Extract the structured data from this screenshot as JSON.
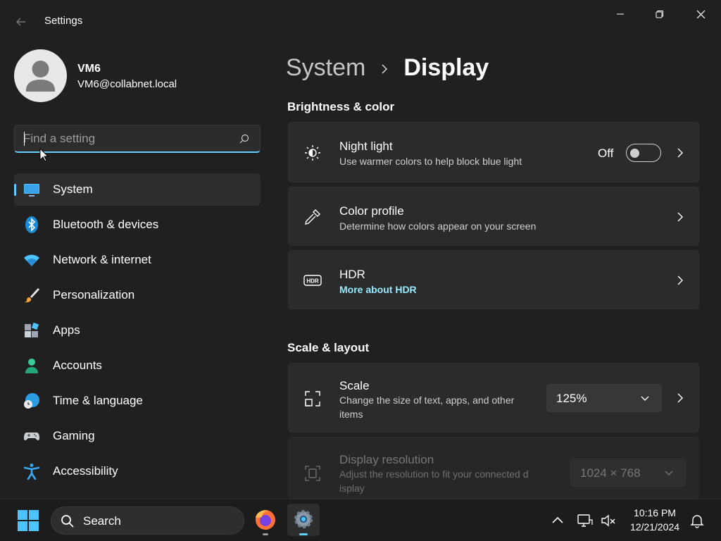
{
  "window": {
    "title": "Settings",
    "back_icon": "back-arrow-icon",
    "controls": [
      "minimize-icon",
      "restore-icon",
      "close-icon"
    ]
  },
  "profile": {
    "name": "VM6",
    "email": "VM6@collabnet.local"
  },
  "search": {
    "placeholder": "Find a setting",
    "value": ""
  },
  "nav": {
    "items": [
      {
        "label": "System",
        "icon": "system-monitor-icon",
        "selected": true
      },
      {
        "label": "Bluetooth & devices",
        "icon": "bluetooth-icon"
      },
      {
        "label": "Network & internet",
        "icon": "wifi-icon"
      },
      {
        "label": "Personalization",
        "icon": "paintbrush-icon"
      },
      {
        "label": "Apps",
        "icon": "apps-icon"
      },
      {
        "label": "Accounts",
        "icon": "person-icon"
      },
      {
        "label": "Time & language",
        "icon": "globe-clock-icon"
      },
      {
        "label": "Gaming",
        "icon": "gamepad-icon"
      },
      {
        "label": "Accessibility",
        "icon": "accessibility-icon"
      }
    ]
  },
  "breadcrumb": {
    "parent": "System",
    "separator": ">",
    "current": "Display"
  },
  "brightness_section": {
    "title": "Brightness & color",
    "night_light": {
      "title": "Night light",
      "subtitle": "Use warmer colors to help block blue light",
      "state": "Off"
    },
    "color_profile": {
      "title": "Color profile",
      "subtitle": "Determine how colors appear on your screen"
    },
    "hdr": {
      "title": "HDR",
      "link": "More about HDR"
    }
  },
  "scale_section": {
    "title": "Scale & layout",
    "scale": {
      "title": "Scale",
      "subtitle_line1": "Change the size of text, apps, and other",
      "subtitle_line2": "items",
      "value": "125%"
    },
    "resolution": {
      "title": "Display resolution",
      "subtitle_line1": "Adjust the resolution to fit your connected d",
      "subtitle_line2": "isplay",
      "value": "1024 × 768"
    }
  },
  "taskbar": {
    "search_label": "Search",
    "time": "10:16 PM",
    "date": "12/21/2024"
  },
  "colors": {
    "accent": "#60cdff",
    "link": "#99ebff",
    "background": "#202020",
    "card": "#2b2b2b"
  }
}
